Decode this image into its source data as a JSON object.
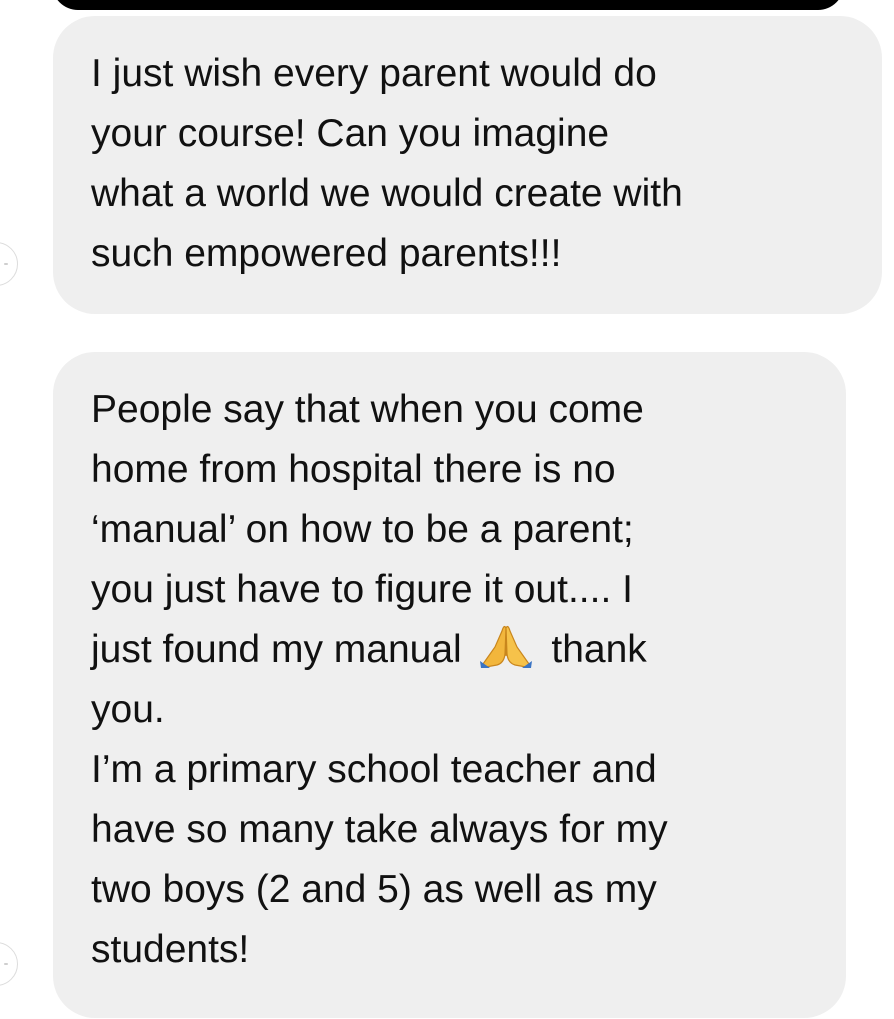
{
  "messages": [
    {
      "lines": [
        "I just wish every parent would do",
        "your course! Can you imagine",
        "what a world we would create with",
        "such empowered parents!!!"
      ]
    },
    {
      "lines": [
        "People say that when you come",
        "home from hospital there is no",
        "‘manual’ on how to be a parent;",
        "you just have to figure it out.... I"
      ],
      "line5_before": "just found my manual",
      "line5_emoji": "folded-hands-emoji",
      "line5_after": "thank",
      "lines_after": [
        "you.",
        "I’m a primary school teacher and",
        "have so many take always for my",
        "two boys (2 and 5) as well as my",
        "students!"
      ]
    }
  ],
  "colors": {
    "bubble": "#efefef",
    "text": "#111111",
    "top_bar": "#000000"
  }
}
